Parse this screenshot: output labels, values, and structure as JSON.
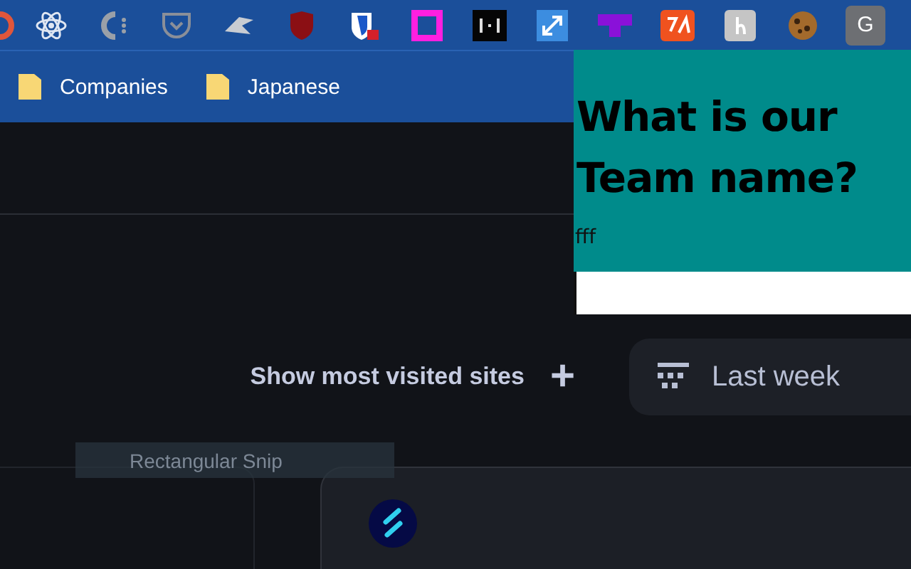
{
  "toolbar": {
    "profile_letter": "G"
  },
  "bookmarks": [
    {
      "label": "Companies"
    },
    {
      "label": "Japanese"
    }
  ],
  "popup": {
    "title": "What is our Team name?",
    "note": "fff"
  },
  "shortcuts": {
    "label": "Show most visited sites",
    "icon": "+"
  },
  "filter": {
    "label": "Last week"
  },
  "tooltip": {
    "label": "Rectangular Snip"
  }
}
